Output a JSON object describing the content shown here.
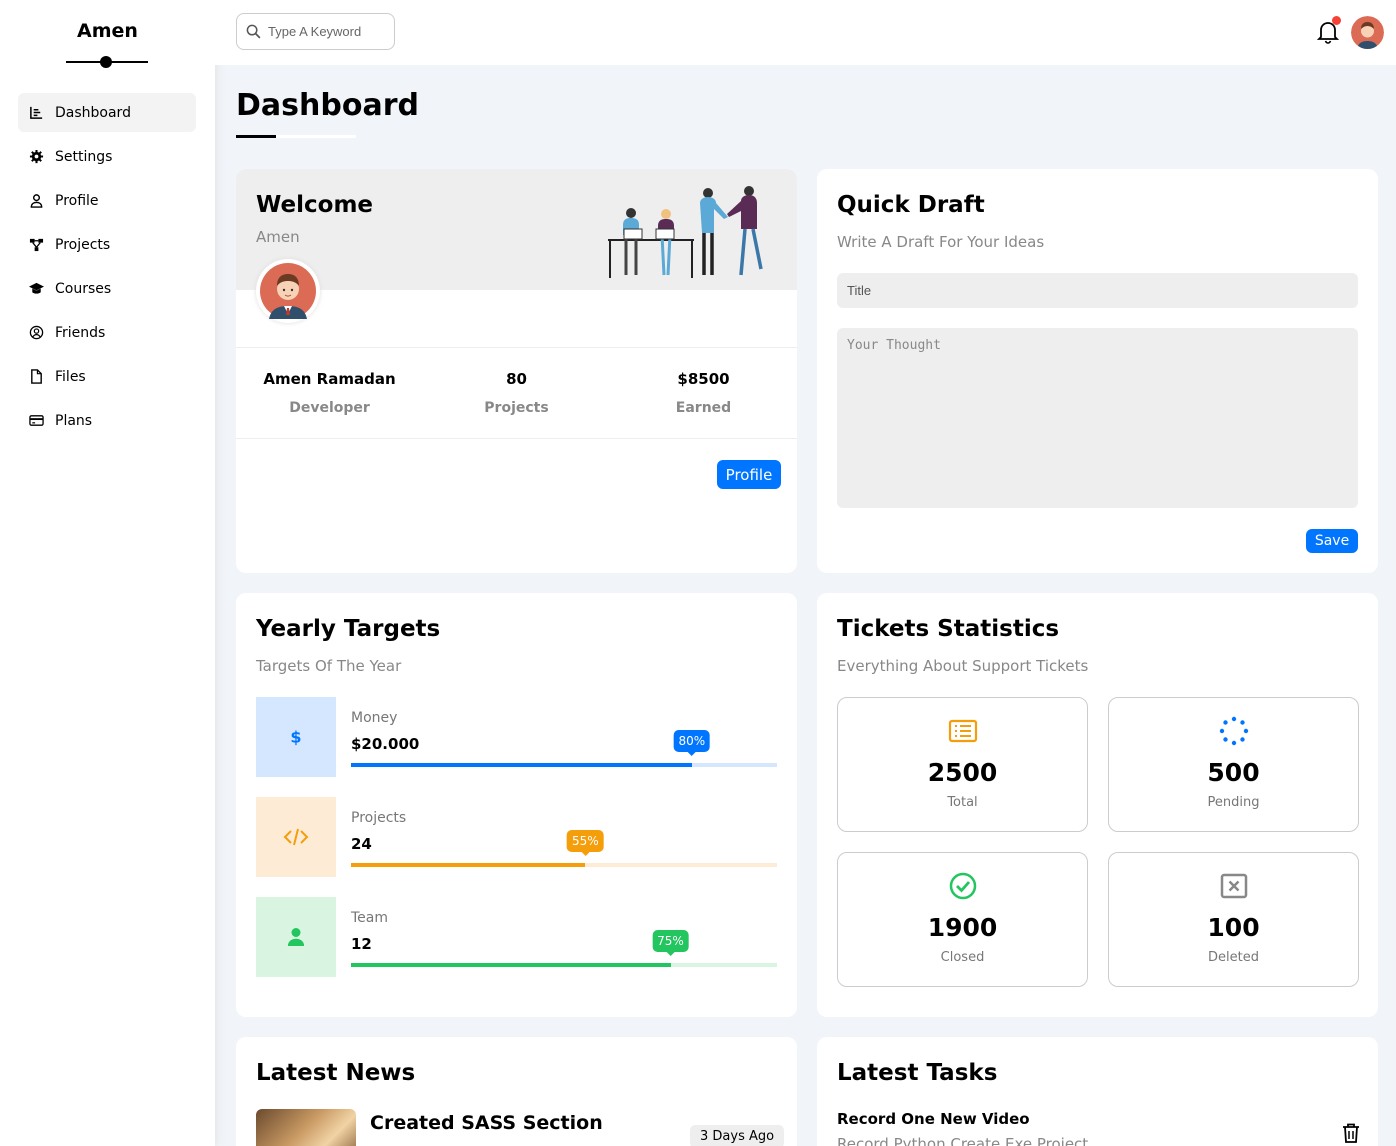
{
  "sidebar": {
    "brand": "Amen",
    "items": [
      {
        "label": "Dashboard",
        "icon": "chart-icon",
        "active": true
      },
      {
        "label": "Settings",
        "icon": "gear-icon"
      },
      {
        "label": "Profile",
        "icon": "user-icon"
      },
      {
        "label": "Projects",
        "icon": "diagram-icon"
      },
      {
        "label": "Courses",
        "icon": "graduation-cap-icon"
      },
      {
        "label": "Friends",
        "icon": "user-circle-icon"
      },
      {
        "label": "Files",
        "icon": "file-icon"
      },
      {
        "label": "Plans",
        "icon": "credit-card-icon"
      }
    ]
  },
  "header": {
    "search_placeholder": "Type A Keyword"
  },
  "page": {
    "title": "Dashboard"
  },
  "welcome": {
    "title": "Welcome",
    "name": "Amen",
    "stats": [
      {
        "value": "Amen Ramadan",
        "label": "Developer"
      },
      {
        "value": "80",
        "label": "Projects"
      },
      {
        "value": "$8500",
        "label": "Earned"
      }
    ],
    "button": "Profile"
  },
  "draft": {
    "title": "Quick Draft",
    "subtitle": "Write A Draft For Your Ideas",
    "title_placeholder": "Title",
    "body_placeholder": "Your Thought",
    "button": "Save"
  },
  "targets": {
    "title": "Yearly Targets",
    "subtitle": "Targets Of The Year",
    "items": [
      {
        "label": "Money",
        "value": "$20.000",
        "percent": "80%",
        "progress": 0.8,
        "icon": "dollar-icon",
        "color": "#0075ff",
        "bg": "#d5e6ff",
        "track": "#d5e6ff"
      },
      {
        "label": "Projects",
        "value": "24",
        "percent": "55%",
        "progress": 0.55,
        "icon": "code-icon",
        "color": "#f59e0b",
        "bg": "#fdebd6",
        "track": "#fdebd6"
      },
      {
        "label": "Team",
        "value": "12",
        "percent": "75%",
        "progress": 0.75,
        "icon": "user-icon",
        "color": "#22c55e",
        "bg": "#d9f5e1",
        "track": "#d9f5e1"
      }
    ]
  },
  "tickets": {
    "title": "Tickets Statistics",
    "subtitle": "Everything About Support Tickets",
    "items": [
      {
        "value": "2500",
        "label": "Total",
        "icon": "list-icon",
        "color": "#f59e0b"
      },
      {
        "value": "500",
        "label": "Pending",
        "icon": "spinner-icon",
        "color": "#0075ff"
      },
      {
        "value": "1900",
        "label": "Closed",
        "icon": "check-circle-icon",
        "color": "#22c55e"
      },
      {
        "value": "100",
        "label": "Deleted",
        "icon": "x-square-icon",
        "color": "#888888"
      }
    ]
  },
  "news": {
    "title": "Latest News",
    "items": [
      {
        "title": "Created SASS Section",
        "date": "3 Days Ago"
      }
    ]
  },
  "tasks": {
    "title": "Latest Tasks",
    "items": [
      {
        "title": "Record One New Video",
        "subtitle": "Record Python Create Exe Project"
      }
    ]
  }
}
